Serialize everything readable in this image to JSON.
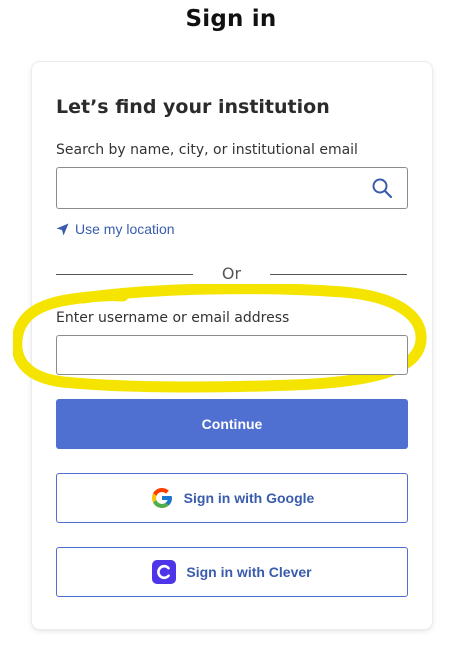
{
  "page": {
    "title": "Sign in"
  },
  "institution": {
    "heading": "Let’s find your institution",
    "search_label": "Search by name, city, or institutional email",
    "search_value": "",
    "location_link": "Use my location"
  },
  "divider": {
    "text": "Or"
  },
  "login": {
    "username_label": "Enter username or email address",
    "username_value": "",
    "continue_label": "Continue"
  },
  "sso": {
    "google_label": "Sign in with Google",
    "clever_label": "Sign in with Clever"
  },
  "icons": {
    "search": "search-icon",
    "location": "location-arrow-icon",
    "google": "google-logo-icon",
    "clever": "clever-logo-icon"
  },
  "colors": {
    "primary": "#4f6fd1",
    "link": "#3a5cad",
    "highlight": "#f5e400",
    "clever": "#4e36e8"
  }
}
